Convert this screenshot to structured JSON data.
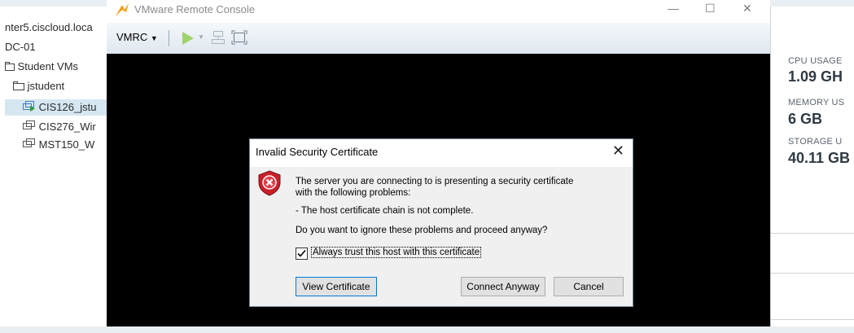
{
  "vsphere": {
    "tree": {
      "host": "nter5.ciscloud.loca",
      "datacenter": "DC-01",
      "folder_student": "Student VMs",
      "folder_jstudent": "jstudent",
      "vm1": "CIS126_jstu",
      "vm2": "CIS276_Wir",
      "vm3": "MST150_W"
    },
    "summary": {
      "cpu_label": "CPU USAGE",
      "cpu_value": "1.09 GH",
      "memory_label": "MEMORY US",
      "memory_value": "6 GB",
      "storage_label": "STORAGE U",
      "storage_value": "40.11 GB"
    }
  },
  "vmrc": {
    "title": "VMware Remote Console",
    "menu_label": "VMRC",
    "window_controls": {
      "minimize": "—",
      "maximize": "☐",
      "close": "✕"
    }
  },
  "dialog": {
    "title": "Invalid Security Certificate",
    "close_glyph": "✕",
    "message_line1": "The server you are connecting to is presenting a security certificate",
    "message_line2": "with the following problems:",
    "problem": "- The host certificate chain is not complete.",
    "question": "Do you want to ignore these problems and proceed anyway?",
    "checkbox_label": "Always trust this host with this certificate",
    "checkbox_checked": true,
    "buttons": {
      "view": "View Certificate",
      "connect": "Connect Anyway",
      "cancel": "Cancel"
    }
  },
  "colors": {
    "shield_red": "#c8202a",
    "accent_blue": "#0078d7",
    "play_green": "#7ac143"
  }
}
